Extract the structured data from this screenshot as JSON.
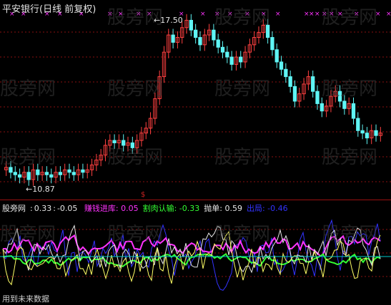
{
  "title": "平安银行(日线 前复权)",
  "watermark": "股旁网",
  "price_panel": {
    "high_label": "17.50",
    "low_label": "10.87",
    "marker": "$"
  },
  "indicator_panel": {
    "name": "股旁网",
    "v1": "0.33",
    "v2": "-0.05",
    "items": [
      {
        "label": "赚钱进库",
        "value": "0.05",
        "color": "#ff33ff"
      },
      {
        "label": "割肉认输",
        "value": "-0.33",
        "color": "#33ff33"
      },
      {
        "label": "抛单",
        "value": "0.59",
        "color": "#e6e6e6"
      },
      {
        "label": "出局",
        "value": "-0.46",
        "color": "#3333ff"
      }
    ]
  },
  "footer": "用到未来数据",
  "colors": {
    "up": "#ff4040",
    "down": "#5ff5f5",
    "grid": "#8a1010",
    "x_marks": "#ff33ff"
  },
  "chart_data": {
    "type": "candlestick",
    "y_max": 17.5,
    "y_min": 10.87,
    "closes": [
      11.5,
      11.3,
      11.2,
      11.1,
      11.3,
      11.0,
      11.4,
      11.2,
      11.3,
      11.2,
      11.1,
      11.3,
      11.2,
      11.4,
      11.3,
      11.2,
      11.4,
      11.3,
      11.4,
      11.6,
      11.8,
      12.0,
      12.4,
      12.6,
      12.5,
      12.6,
      12.4,
      12.5,
      12.3,
      12.6,
      12.9,
      13.1,
      13.5,
      14.3,
      15.2,
      16.2,
      16.9,
      16.6,
      16.8,
      17.2,
      17.5,
      17.1,
      16.8,
      16.5,
      16.9,
      17.1,
      16.7,
      16.4,
      16.2,
      16.0,
      15.7,
      16.0,
      15.8,
      16.2,
      16.5,
      16.8,
      17.0,
      17.3,
      16.8,
      16.3,
      15.8,
      15.5,
      15.2,
      14.8,
      14.2,
      14.5,
      14.9,
      15.2,
      14.6,
      14.1,
      13.8,
      14.0,
      14.4,
      14.6,
      14.2,
      13.9,
      14.1,
      13.5,
      13.0,
      12.9,
      12.7,
      13.0,
      12.8,
      12.9
    ]
  }
}
